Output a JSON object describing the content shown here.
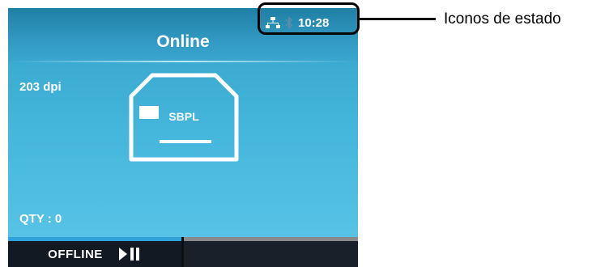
{
  "header": {
    "title": "Online",
    "clock": "10:28",
    "status_icons": [
      "network-icon",
      "bluetooth-icon"
    ]
  },
  "main": {
    "resolution": "203 dpi",
    "printer_label": "SBPL",
    "quantity": "QTY : 0"
  },
  "softkeys": {
    "left_label": "OFFLINE",
    "left_icon": "play-pause-icon",
    "right_label": ""
  },
  "annotation": {
    "status_icons_label": "Iconos de estado"
  },
  "colors": {
    "screen_background": "#45b7dc",
    "title_bar": "#2f93b8",
    "bottom_bar": "#121922",
    "active_strip": "#2fa2dc",
    "inactive_strip": "#8a8a8a"
  }
}
